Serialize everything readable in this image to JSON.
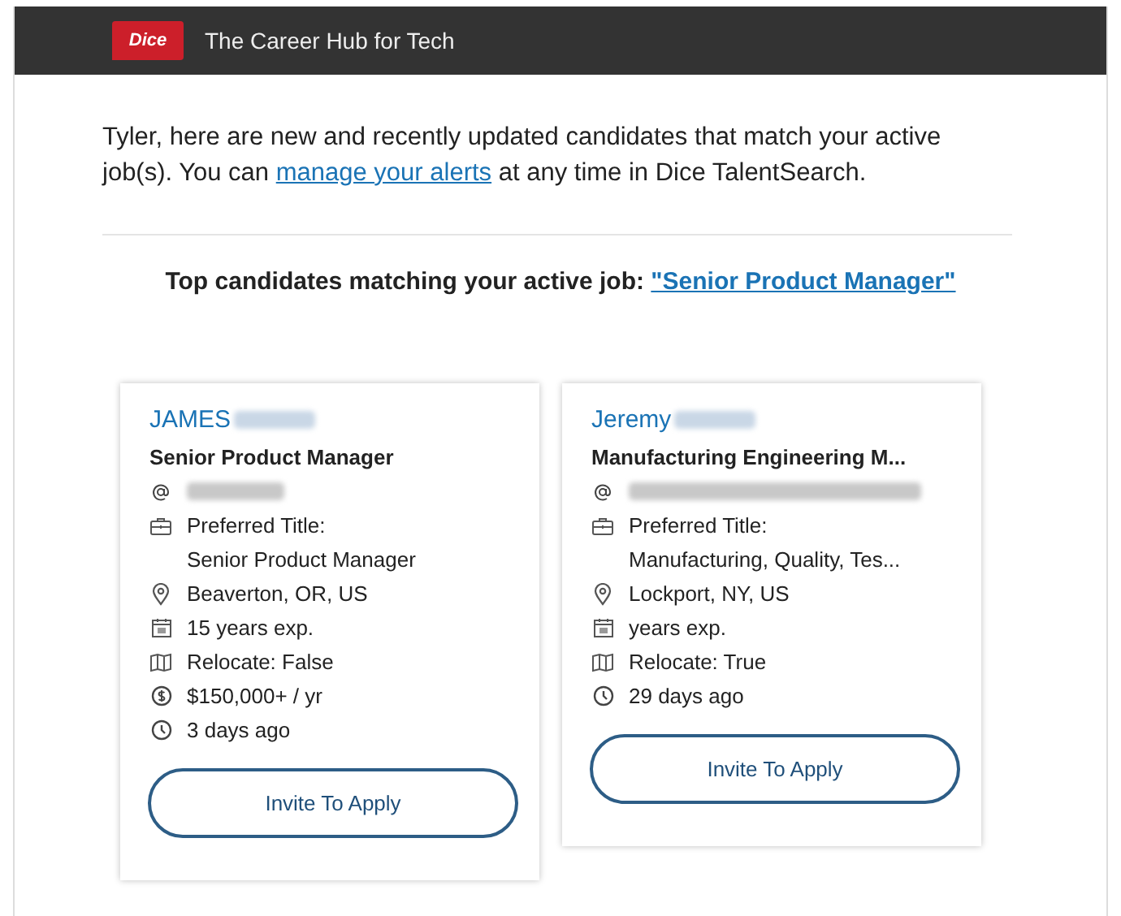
{
  "header": {
    "logo": "Dice",
    "tagline": "The Career Hub for Tech"
  },
  "intro": {
    "before": "Tyler, here are new and recently updated candidates that match your active job(s). You can ",
    "link": "manage your alerts",
    "after": " at any time in Dice TalentSearch."
  },
  "section": {
    "heading": "Top candidates matching your active job: ",
    "job_link": "\"Senior Product Manager\""
  },
  "candidates": [
    {
      "name": "JAMES",
      "surname_blurred": true,
      "headline": "Senior Product Manager",
      "company_blurred": true,
      "details": [
        {
          "kind": "briefcase",
          "text": "Preferred Title:",
          "subtext": "Senior Product Manager"
        },
        {
          "kind": "location",
          "text": "Beaverton, OR, US"
        },
        {
          "kind": "calendar",
          "text": "15 years exp."
        },
        {
          "kind": "map",
          "text": "Relocate: False"
        },
        {
          "kind": "money",
          "text": "$150,000+ / yr"
        },
        {
          "kind": "clock",
          "text": "3 days ago"
        }
      ],
      "button": "Invite To Apply"
    },
    {
      "name": "Jeremy",
      "surname_blurred": true,
      "headline": "Manufacturing Engineering M...",
      "company_blurred": true,
      "details": [
        {
          "kind": "briefcase",
          "text": "Preferred Title:",
          "subtext": "Manufacturing, Quality, Tes..."
        },
        {
          "kind": "location",
          "text": "Lockport, NY, US"
        },
        {
          "kind": "calendar",
          "text": "years exp."
        },
        {
          "kind": "map",
          "text": "Relocate: True"
        },
        {
          "kind": "clock",
          "text": "29 days ago"
        }
      ],
      "button": "Invite To Apply"
    }
  ]
}
